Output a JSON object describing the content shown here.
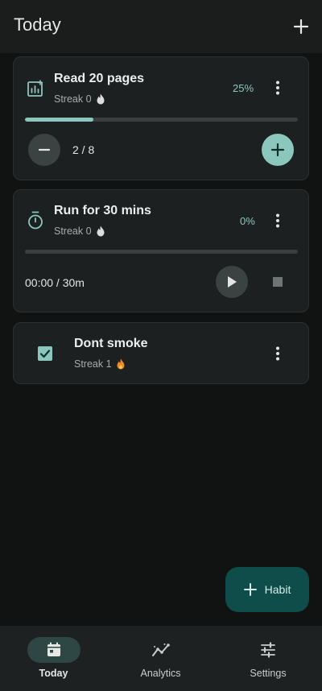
{
  "header": {
    "title": "Today",
    "add_icon": "plus-icon"
  },
  "habits": [
    {
      "name": "Read 20 pages",
      "type": "counter",
      "icon": "chart-icon",
      "streak": "Streak 0",
      "percent": "25%",
      "progress": 0.25,
      "count": "2 / 8"
    },
    {
      "name": "Run for 30 mins",
      "type": "timer",
      "icon": "timer-icon",
      "streak": "Streak 0",
      "percent": "0%",
      "progress": 0,
      "timer": "00:00 / 30m"
    },
    {
      "name": "Dont smoke",
      "type": "checkbox",
      "icon": "checkbox-icon",
      "streak": "Streak 1",
      "checked": true
    }
  ],
  "fab": {
    "label": "Habit"
  },
  "nav": [
    {
      "label": "Today",
      "icon": "calendar-icon",
      "active": true
    },
    {
      "label": "Analytics",
      "icon": "analytics-icon",
      "active": false
    },
    {
      "label": "Settings",
      "icon": "sliders-icon",
      "active": false
    }
  ],
  "colors": {
    "accent": "#8cc7bd",
    "fab_bg": "#0e4d49",
    "card_bg": "#1d2020",
    "background": "#111313",
    "flame_active": "#f08a2a",
    "flame_inactive": "#dcdcdc"
  }
}
